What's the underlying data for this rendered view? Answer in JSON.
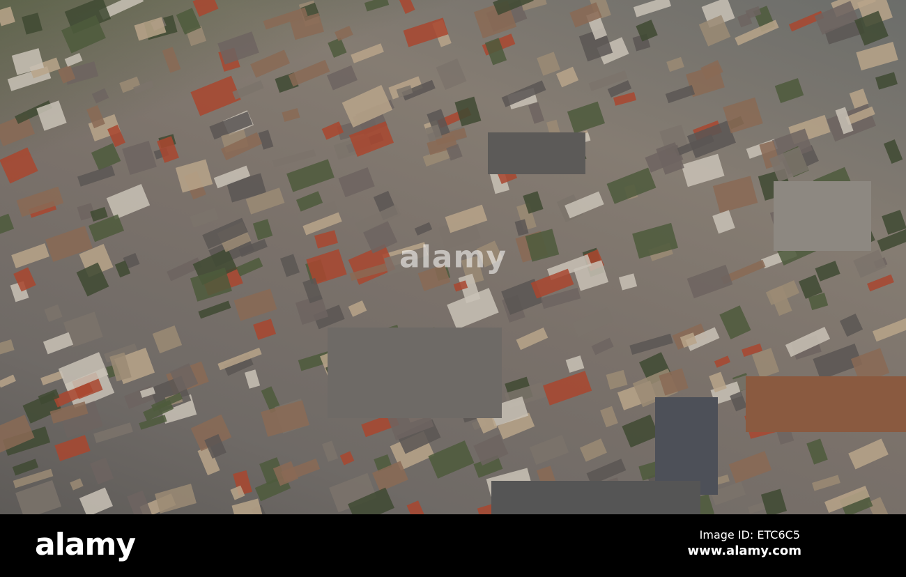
{
  "photo": {
    "description_label": "aerial-city-view"
  },
  "watermark": {
    "text": "alamy"
  },
  "footer": {
    "logo": "alamy",
    "image_id": "Image ID: ETC6C5",
    "website": "www.alamy.com"
  }
}
